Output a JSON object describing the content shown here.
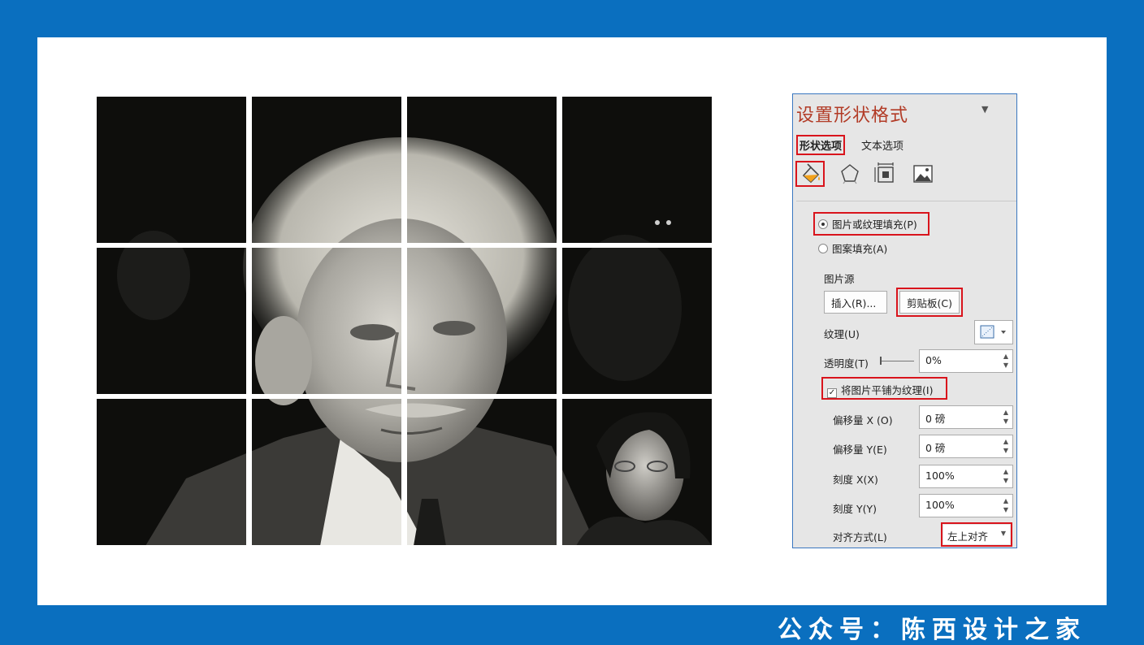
{
  "panel": {
    "title": "设置形状格式",
    "tabs": {
      "shape_options": "形状选项",
      "text_options": "文本选项"
    },
    "icons": [
      "fill-line-icon",
      "effects-icon",
      "size-properties-icon",
      "picture-icon"
    ],
    "fill": {
      "picture_texture_fill": "图片或纹理填充(P)",
      "pattern_fill": "图案填充(A)",
      "picture_source_label": "图片源",
      "insert_button": "插入(R)...",
      "clipboard_button": "剪贴板(C)",
      "texture_label": "纹理(U)",
      "transparency_label": "透明度(T)",
      "transparency_value": "0%",
      "tile_checkbox": "将图片平铺为纹理(I)",
      "offset_x_label": "偏移量 X (O)",
      "offset_x_value": "0 磅",
      "offset_y_label": "偏移量 Y(E)",
      "offset_y_value": "0 磅",
      "scale_x_label": "刻度 X(X)",
      "scale_x_value": "100%",
      "scale_y_label": "刻度 Y(Y)",
      "scale_y_value": "100%",
      "alignment_label": "对齐方式(L)",
      "alignment_value": "左上对齐"
    }
  },
  "footer": {
    "text": "公众号：陈西设计之家"
  },
  "colors": {
    "background": "#0a6fbf",
    "highlight": "#d9141c",
    "title": "#b23b26"
  }
}
